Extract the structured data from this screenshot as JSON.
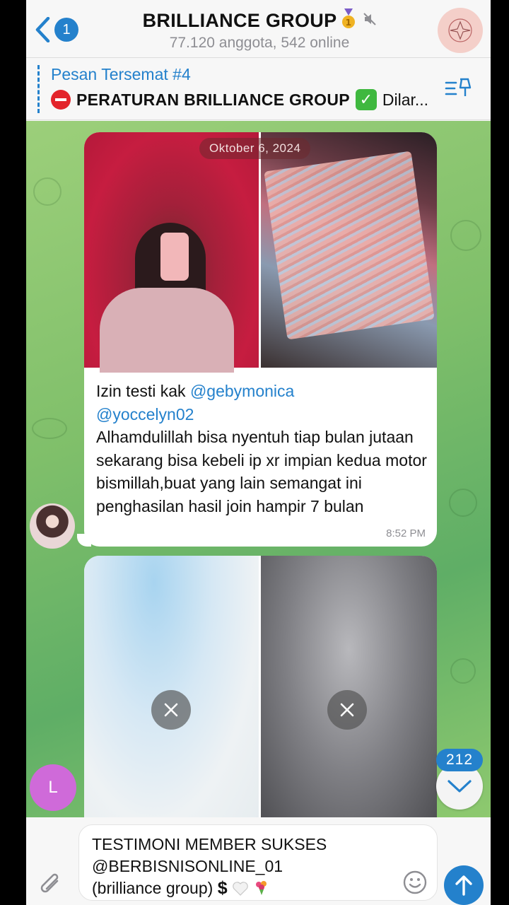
{
  "header": {
    "back_count": "1",
    "title": "BRILLIANCE GROUP",
    "subtitle": "77.120 anggota, 542 online"
  },
  "pinned": {
    "title": "Pesan Tersemat #4",
    "text": "PERATURAN BRILLIANCE GROUP",
    "text_suffix": "Dilar..."
  },
  "message1": {
    "date": "Oktober 6, 2024",
    "line_start": "Izin testi kak ",
    "mention1": "@gebymonica",
    "mention2": "@yoccelyn02",
    "body": "Alhamdulillah bisa nyentuh tiap bulan jutaan sekarang bisa kebeli ip xr impian kedua motor bismillah,buat yang lain semangat ini penghasilan hasil join hampir 7 bulan",
    "time": "8:52 PM"
  },
  "sender2_initial": "L",
  "unread_count": "212",
  "composer": {
    "line1": "TESTIMONI MEMBER SUKSES",
    "line2": "@BERBISNISONLINE_01",
    "line3": "(brilliance group)",
    "symbol": "$"
  },
  "colors": {
    "accent": "#2481cc",
    "chat_bg": "#7fbf6a"
  },
  "icons": [
    "back-chevron-icon",
    "medal-icon",
    "mute-icon",
    "group-logo-icon",
    "pin-list-icon",
    "no-entry-icon",
    "check-icon",
    "cancel-download-icon",
    "chevron-down-icon",
    "paperclip-icon",
    "emoji-icon",
    "send-arrow-icon",
    "heart-icon",
    "bouquet-icon"
  ]
}
